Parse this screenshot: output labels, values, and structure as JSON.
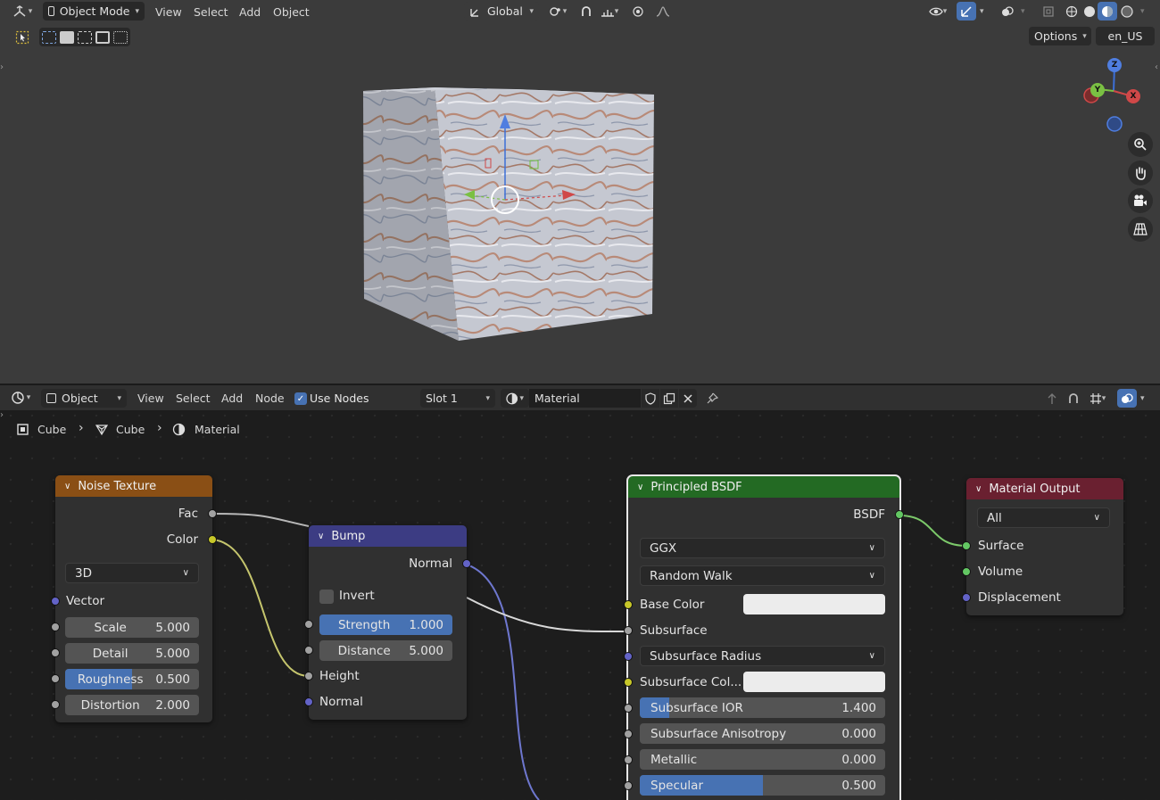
{
  "viewport_header": {
    "mode": "Object Mode",
    "menus": [
      "View",
      "Select",
      "Add",
      "Object"
    ],
    "orientation": "Global",
    "options": "Options",
    "language": "en_US"
  },
  "gizmo": {
    "z": "Z",
    "x": "X",
    "y": "Y"
  },
  "node_header": {
    "editor_type": "Object",
    "menus": [
      "View",
      "Select",
      "Add",
      "Node"
    ],
    "use_nodes": "Use Nodes",
    "slot": "Slot 1",
    "material": "Material"
  },
  "breadcrumb": [
    "Cube",
    "Cube",
    "Material"
  ],
  "nodes": {
    "noise": {
      "title": "Noise Texture",
      "out_fac": "Fac",
      "out_color": "Color",
      "dimensions": "3D",
      "in_vector": "Vector",
      "scale_label": "Scale",
      "scale_value": "5.000",
      "detail_label": "Detail",
      "detail_value": "5.000",
      "roughness_label": "Roughness",
      "roughness_value": "0.500",
      "roughness_fraction": 0.5,
      "distortion_label": "Distortion",
      "distortion_value": "2.000"
    },
    "bump": {
      "title": "Bump",
      "out_normal": "Normal",
      "invert": "Invert",
      "strength_label": "Strength",
      "strength_value": "1.000",
      "strength_fraction": 1.0,
      "distance_label": "Distance",
      "distance_value": "5.000",
      "in_height": "Height",
      "in_normal": "Normal"
    },
    "bsdf": {
      "title": "Principled BSDF",
      "out_bsdf": "BSDF",
      "distribution": "GGX",
      "subsurface_method": "Random Walk",
      "base_color": "Base Color",
      "subsurface": "Subsurface",
      "subsurface_radius": "Subsurface Radius",
      "subsurface_color": "Subsurface Col...",
      "subsurface_ior_label": "Subsurface IOR",
      "subsurface_ior_value": "1.400",
      "subsurface_ior_fraction": 0.12,
      "aniso_label": "Subsurface Anisotropy",
      "aniso_value": "0.000",
      "metallic_label": "Metallic",
      "metallic_value": "0.000",
      "specular_label": "Specular",
      "specular_value": "0.500",
      "specular_fraction": 0.5
    },
    "output": {
      "title": "Material Output",
      "target": "All",
      "surface": "Surface",
      "volume": "Volume",
      "displacement": "Displacement"
    }
  },
  "colors": {
    "noise_header": "#8a4f15",
    "bump_header": "#3c3c83",
    "bsdf_header": "#236a23",
    "output_header": "#6a2030",
    "accent": "#4772b3"
  }
}
